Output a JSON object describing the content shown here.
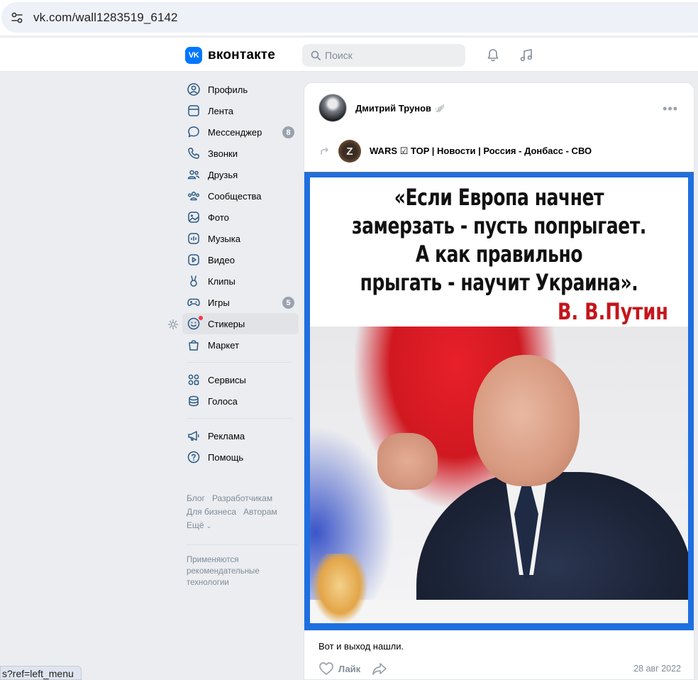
{
  "browser": {
    "url": "vk.com/wall1283519_6142",
    "status_url": "s?ref=left_menu"
  },
  "header": {
    "logo_text": "вконтакте",
    "logo_mark": "VK",
    "search_placeholder": "Поиск",
    "accent_color": "#0077ff"
  },
  "menu": {
    "items": [
      {
        "label": "Профиль",
        "icon": "profile-icon"
      },
      {
        "label": "Лента",
        "icon": "news-icon"
      },
      {
        "label": "Мессенджер",
        "icon": "messenger-icon",
        "badge": "8"
      },
      {
        "label": "Звонки",
        "icon": "phone-icon"
      },
      {
        "label": "Друзья",
        "icon": "friends-icon"
      },
      {
        "label": "Сообщества",
        "icon": "communities-icon"
      },
      {
        "label": "Фото",
        "icon": "photo-icon"
      },
      {
        "label": "Музыка",
        "icon": "music-icon"
      },
      {
        "label": "Видео",
        "icon": "video-icon"
      },
      {
        "label": "Клипы",
        "icon": "clips-icon"
      },
      {
        "label": "Игры",
        "icon": "games-icon",
        "badge": "5"
      },
      {
        "label": "Стикеры",
        "icon": "stickers-icon"
      },
      {
        "label": "Маркет",
        "icon": "market-icon"
      }
    ],
    "items2": [
      {
        "label": "Сервисы",
        "icon": "services-icon"
      },
      {
        "label": "Голоса",
        "icon": "votes-icon"
      }
    ],
    "items3": [
      {
        "label": "Реклама",
        "icon": "ads-icon"
      },
      {
        "label": "Помощь",
        "icon": "help-icon"
      }
    ],
    "footer_links": [
      "Блог",
      "Разработчикам",
      "Для бизнеса",
      "Авторам",
      "Ещё"
    ],
    "footer_note": "Применяются рекомендательные технологии"
  },
  "post": {
    "author": "Дмитрий Трунов",
    "verified_mark": "🪽",
    "more": "•••",
    "repost_avatar_letter": "Z",
    "repost_group": "WARS ☑ TOP | Новости | Россия - Донбасс - СВО",
    "image_quote_lines": [
      "«Если Европа начнет",
      "замерзать - пусть попрыгает.",
      "А как правильно",
      "прыгать - научит Украина»."
    ],
    "image_quote_author": "В. В.Путин",
    "text": "Вот и выход нашли.",
    "like_label": "Лайк",
    "date": "28 авг 2022"
  }
}
